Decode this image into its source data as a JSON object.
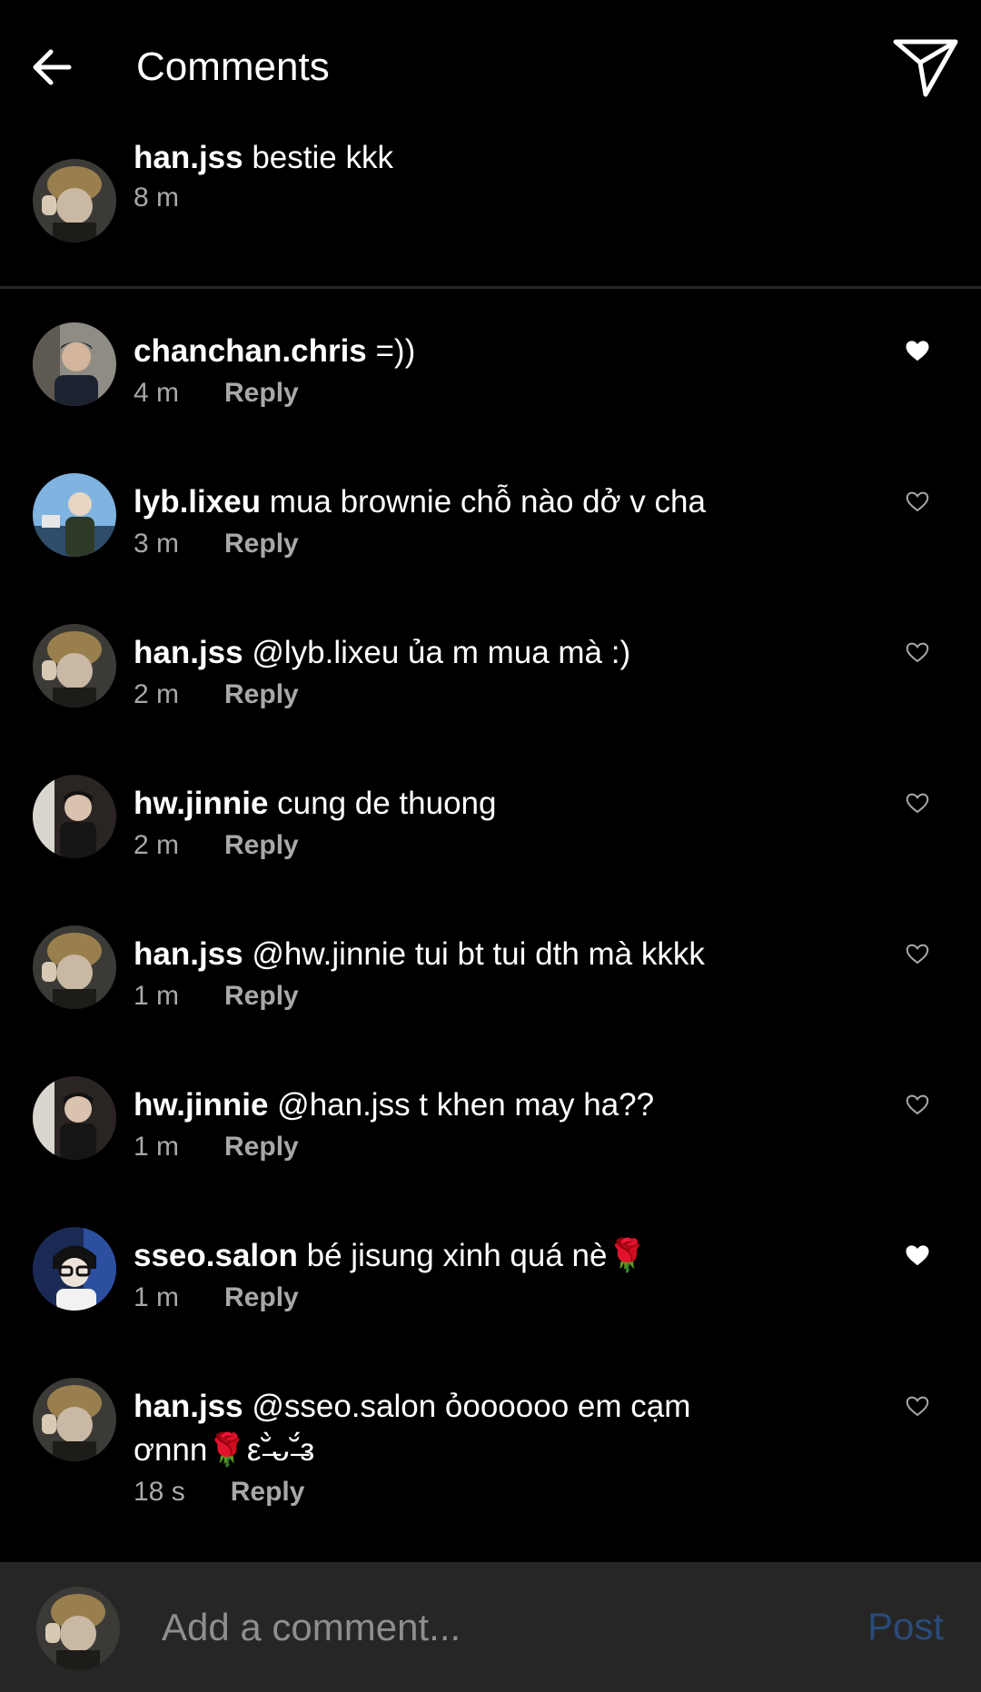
{
  "header": {
    "title": "Comments",
    "back_icon": "arrow-left-icon",
    "send_icon": "paper-plane-icon"
  },
  "caption": {
    "username": "han.jss",
    "text": " bestie kkk",
    "time": "8 m"
  },
  "comments": [
    {
      "username": "chanchan.chris",
      "text": " =))",
      "time": "4 m",
      "reply": "Reply",
      "liked": true,
      "avatar": "chris"
    },
    {
      "username": "lyb.lixeu",
      "text": " mua brownie chỗ nào dở v cha",
      "time": "3 m",
      "reply": "Reply",
      "liked": false,
      "avatar": "lixeu"
    },
    {
      "username": "han.jss",
      "text": " @lyb.lixeu ủa m mua mà :)",
      "time": "2 m",
      "reply": "Reply",
      "liked": false,
      "avatar": "hanjss"
    },
    {
      "username": "hw.jinnie",
      "text": " cung de thuong",
      "time": "2 m",
      "reply": "Reply",
      "liked": false,
      "avatar": "jinnie"
    },
    {
      "username": "han.jss",
      "text": " @hw.jinnie tui bt tui dth mà kkkk",
      "time": "1 m",
      "reply": "Reply",
      "liked": false,
      "avatar": "hanjss"
    },
    {
      "username": "hw.jinnie",
      "text": " @han.jss t khen may ha??",
      "time": "1 m",
      "reply": "Reply",
      "liked": false,
      "avatar": "jinnie"
    },
    {
      "username": "sseo.salon",
      "text": " bé jisung xinh quá nè🌹",
      "time": "1 m",
      "reply": "Reply",
      "liked": true,
      "avatar": "salon"
    },
    {
      "username": "han.jss",
      "text": " @sseo.salon ỏoooooo em cạm ơnnn🌹ε˘̶̀ᴗ˘̶́з",
      "time": "18 s",
      "reply": "Reply",
      "liked": false,
      "avatar": "hanjss"
    }
  ],
  "input": {
    "placeholder": "Add a comment...",
    "post_label": "Post"
  },
  "colors": {
    "background": "#000000",
    "meta": "#a8a8a8",
    "bar": "#262626",
    "post": "#2a4a7a"
  }
}
